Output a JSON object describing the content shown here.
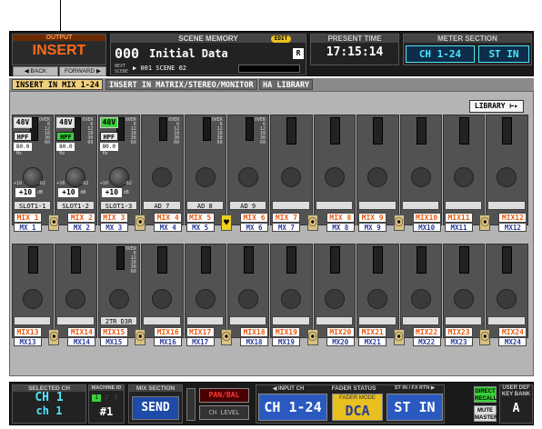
{
  "header": {
    "output_label": "OUTPUT",
    "mode": "INSERT",
    "back": "◀ BACK",
    "forward": "FORWARD ▶",
    "scene_memory_label": "SCENE MEMORY",
    "edit_badge": "EDIT",
    "scene_number": "000",
    "scene_name": "Initial Data",
    "scene_flag": "R",
    "next_label": "NEXT\nSCENE",
    "next_scene": "▶ 001 SCENE 02",
    "present_time_label": "PRESENT TIME",
    "time": "17:15:14",
    "meter_section_label": "METER SECTION",
    "meter_left": "CH 1-24",
    "meter_right": "ST IN"
  },
  "tabs": [
    {
      "label": "INSERT IN MIX 1-24",
      "active": true
    },
    {
      "label": "INSERT IN MATRIX/STEREO/MONITOR",
      "active": false
    },
    {
      "label": "HA LIBRARY",
      "active": false
    }
  ],
  "library_button": "LIBRARY ⊢▸",
  "strips": {
    "phantom": "48V",
    "hpf": "HPF",
    "hpf_freq": "80.0",
    "hz": "Hz",
    "gain_min": "+10",
    "gain_max": "-62",
    "gain_value": "+10",
    "db": "dB",
    "meter_scale": [
      "OVER",
      "6",
      "12",
      "18",
      "30",
      "60"
    ],
    "row1_slots": [
      "SLOT1-1",
      "SLOT1-2",
      "SLOT1-3",
      "AD 7",
      "AD 8",
      "AD 9",
      "",
      "",
      "",
      "",
      "",
      ""
    ],
    "row2_slots": [
      "",
      "",
      "2TR D3R",
      "",
      "",
      "",
      "",
      "",
      "",
      "",
      "",
      ""
    ],
    "row1_mix": [
      "MIX 1",
      "MIX 2",
      "MIX 3",
      "MIX 4",
      "MIX 5",
      "MIX 6",
      "MIX 7",
      "MIX 8",
      "MIX 9",
      "MIX10",
      "MIX11",
      "MIX12"
    ],
    "row1_mx": [
      "MX 1",
      "MX 2",
      "MX 3",
      "MX 4",
      "MX 5",
      "MX 6",
      "MX 7",
      "MX 8",
      "MX 9",
      "MX10",
      "MX11",
      "MX12"
    ],
    "row2_mix": [
      "MIX13",
      "MIX14",
      "MIX15",
      "MIX16",
      "MIX17",
      "MIX18",
      "MIX19",
      "MIX20",
      "MIX21",
      "MIX22",
      "MIX23",
      "MIX24"
    ],
    "row2_mx": [
      "MX13",
      "MX14",
      "MX15",
      "MX16",
      "MX17",
      "MX18",
      "MX19",
      "MX20",
      "MX21",
      "MX22",
      "MX23",
      "MX24"
    ]
  },
  "footer": {
    "selected_ch_label": "SELECTED CH",
    "selected_ch": "CH  1",
    "selected_ch_name": "ch  1",
    "machine_id_label": "MACHINE ID",
    "machine_ids": [
      "1",
      "2",
      "3"
    ],
    "machine_value": "#1",
    "mix_section_label": "MIX SECTION",
    "send": "SEND",
    "panbal": "PAN/BAL",
    "chlevel": "CH LEVEL",
    "input_ch_label": "◀ INPUT CH",
    "input_ch": "CH 1-24",
    "fader_status_label": "FADER STATUS",
    "fader_mode_label": "FADER MODE",
    "fader_mode": "DCA",
    "st_in_label": "ST IN / FX RTN ▶",
    "st_in": "ST IN",
    "direct_recall": "DIRECT\nRECALL",
    "mute_master": "MUTE\nMASTER",
    "user_def_label": "USER DEF\nKEY BANK",
    "user_def_value": "A"
  },
  "colors": {
    "accent_orange": "#ff6a1a",
    "accent_cyan": "#4ee6ff",
    "tab_active": "#f0d080",
    "panel": "#b4b4b4"
  }
}
